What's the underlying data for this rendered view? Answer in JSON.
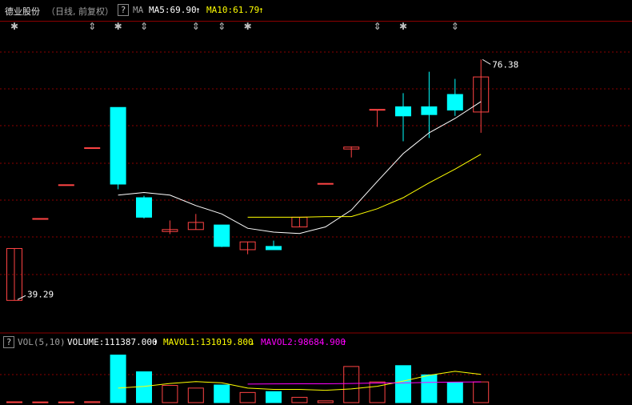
{
  "header": {
    "stock_name": "德业股份",
    "period_label": "（日线, 前复权）",
    "help_label": "?",
    "ma_label": "MA",
    "ma5_text": "MA5:69.90",
    "ma5_arrow": "↑",
    "ma10_text": "MA10:61.79",
    "ma10_arrow": "↑"
  },
  "volume_header": {
    "help_label": "?",
    "vol_label": "VOL(5,10)",
    "volume_text": "VOLUME:111387.000",
    "volume_arrow": "↑",
    "mavol1_text": "MAVOL1:131019.800",
    "mavol1_arrow": "↓",
    "mavol2_text": "MAVOL2:98684.900",
    "mavol2_arrow": "↑"
  },
  "colors": {
    "up": "#ff4444",
    "down": "#00ffff",
    "ma5": "#ffffff",
    "ma10": "#ffff00",
    "mavol2": "#ff00ff",
    "grid": "#8b0000",
    "marker": "#c0c0c0"
  },
  "chart_data": {
    "type": "candlestick",
    "price_scale": {
      "min": 36.0,
      "max": 80.0
    },
    "high_label": "76.38",
    "low_label": "39.29",
    "candles": [
      {
        "o": 39.29,
        "h": 47.28,
        "l": 39.29,
        "c": 47.28,
        "dir": "up",
        "marker": "star"
      },
      {
        "o": 51.9,
        "h": 51.9,
        "l": 51.9,
        "c": 51.9,
        "dir": "up",
        "marker": ""
      },
      {
        "o": 57.1,
        "h": 57.1,
        "l": 57.1,
        "c": 57.1,
        "dir": "up",
        "marker": ""
      },
      {
        "o": 62.8,
        "h": 62.8,
        "l": 62.8,
        "c": 62.8,
        "dir": "up",
        "marker": "tick"
      },
      {
        "o": 69.0,
        "h": 69.0,
        "l": 56.4,
        "c": 57.2,
        "dir": "down",
        "marker": "star"
      },
      {
        "o": 55.1,
        "h": 55.4,
        "l": 51.9,
        "c": 52.1,
        "dir": "down",
        "marker": "tick"
      },
      {
        "o": 49.9,
        "h": 51.6,
        "l": 49.5,
        "c": 50.2,
        "dir": "up",
        "marker": ""
      },
      {
        "o": 50.2,
        "h": 52.6,
        "l": 50.2,
        "c": 51.3,
        "dir": "up",
        "marker": "tick"
      },
      {
        "o": 50.9,
        "h": 50.9,
        "l": 47.5,
        "c": 47.6,
        "dir": "down",
        "marker": "tick"
      },
      {
        "o": 47.1,
        "h": 48.3,
        "l": 46.4,
        "c": 48.3,
        "dir": "up",
        "marker": "star"
      },
      {
        "o": 47.6,
        "h": 48.5,
        "l": 47.1,
        "c": 47.1,
        "dir": "down",
        "marker": ""
      },
      {
        "o": 50.6,
        "h": 52.1,
        "l": 50.6,
        "c": 52.1,
        "dir": "up",
        "marker": ""
      },
      {
        "o": 57.3,
        "h": 57.3,
        "l": 57.3,
        "c": 57.3,
        "dir": "up",
        "marker": ""
      },
      {
        "o": 62.6,
        "h": 63.0,
        "l": 61.3,
        "c": 62.9,
        "dir": "up",
        "marker": ""
      },
      {
        "o": 68.7,
        "h": 68.7,
        "l": 66.0,
        "c": 68.7,
        "dir": "up",
        "marker": "tick"
      },
      {
        "o": 69.1,
        "h": 71.2,
        "l": 63.8,
        "c": 67.7,
        "dir": "down",
        "marker": "star"
      },
      {
        "o": 69.1,
        "h": 74.5,
        "l": 64.3,
        "c": 67.9,
        "dir": "down",
        "marker": ""
      },
      {
        "o": 71.0,
        "h": 73.4,
        "l": 67.7,
        "c": 68.6,
        "dir": "down",
        "marker": "tick"
      },
      {
        "o": 68.3,
        "h": 76.38,
        "l": 65.1,
        "c": 73.7,
        "dir": "up",
        "marker": ""
      }
    ],
    "ma5": [
      null,
      null,
      null,
      null,
      55.5,
      55.9,
      55.5,
      53.9,
      52.6,
      50.4,
      49.8,
      49.6,
      50.6,
      53.2,
      57.6,
      61.9,
      65.1,
      67.3,
      69.9
    ],
    "ma10": [
      null,
      null,
      null,
      null,
      null,
      null,
      null,
      null,
      null,
      52.1,
      52.1,
      52.1,
      52.2,
      52.2,
      53.4,
      55.1,
      57.4,
      59.5,
      61.79
    ],
    "volume": [
      1800,
      1500,
      1400,
      2100,
      108000,
      70000,
      39000,
      33000,
      40000,
      23000,
      25000,
      12000,
      4000,
      82000,
      47000,
      84000,
      63000,
      46000,
      47000
    ],
    "mavol1": [
      null,
      null,
      null,
      null,
      33000,
      36800,
      43500,
      47600,
      45000,
      33000,
      30000,
      30000,
      28000,
      31000,
      37000,
      49000,
      62000,
      71000,
      64000
    ],
    "mavol2": [
      null,
      null,
      null,
      null,
      null,
      null,
      null,
      null,
      null,
      42000,
      42500,
      42700,
      42800,
      43500,
      44500,
      44800,
      45800,
      46600,
      47000
    ],
    "vol_max": 120000
  }
}
